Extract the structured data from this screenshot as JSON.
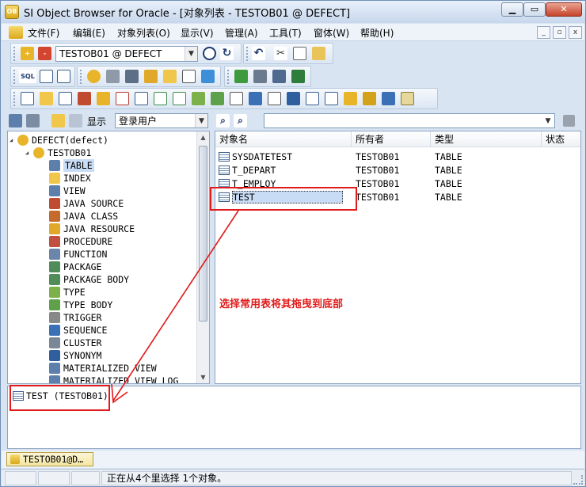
{
  "window": {
    "title": "SI Object Browser for Oracle - [对象列表 - TESTOB01 @ DEFECT]",
    "min_label": "▁",
    "max_label": "▭",
    "close_label": "✕"
  },
  "menu": {
    "items": [
      "文件(F)",
      "编辑(E)",
      "对象列表(O)",
      "显示(V)",
      "管理(A)",
      "工具(T)",
      "窗体(W)",
      "帮助(H)"
    ]
  },
  "toolbar1": {
    "connection": "TESTOB01 @ DEFECT"
  },
  "toolbar2": {
    "sql_label": "SQL"
  },
  "left": {
    "display_label": "显示",
    "display_value": "登录用户",
    "tree": [
      {
        "label": "DEFECT(defect)",
        "level": 0,
        "icon": "db-icon"
      },
      {
        "label": "TESTOB01",
        "level": 1,
        "icon": "user-icon"
      },
      {
        "label": "TABLE",
        "level": 2,
        "icon": "table-icon",
        "selected": true
      },
      {
        "label": "INDEX",
        "level": 2,
        "icon": "index-icon"
      },
      {
        "label": "VIEW",
        "level": 2,
        "icon": "view-icon"
      },
      {
        "label": "JAVA SOURCE",
        "level": 2,
        "icon": "java-source-icon"
      },
      {
        "label": "JAVA CLASS",
        "level": 2,
        "icon": "java-class-icon"
      },
      {
        "label": "JAVA RESOURCE",
        "level": 2,
        "icon": "java-resource-icon"
      },
      {
        "label": "PROCEDURE",
        "level": 2,
        "icon": "procedure-icon"
      },
      {
        "label": "FUNCTION",
        "level": 2,
        "icon": "function-icon"
      },
      {
        "label": "PACKAGE",
        "level": 2,
        "icon": "package-icon"
      },
      {
        "label": "PACKAGE BODY",
        "level": 2,
        "icon": "package-body-icon"
      },
      {
        "label": "TYPE",
        "level": 2,
        "icon": "type-icon"
      },
      {
        "label": "TYPE BODY",
        "level": 2,
        "icon": "type-body-icon"
      },
      {
        "label": "TRIGGER",
        "level": 2,
        "icon": "trigger-icon"
      },
      {
        "label": "SEQUENCE",
        "level": 2,
        "icon": "sequence-icon"
      },
      {
        "label": "CLUSTER",
        "level": 2,
        "icon": "cluster-icon"
      },
      {
        "label": "SYNONYM",
        "level": 2,
        "icon": "synonym-icon"
      },
      {
        "label": "MATERIALIZED VIEW",
        "level": 2,
        "icon": "mview-icon"
      },
      {
        "label": "MATERIALIZED VIEW LOG",
        "level": 2,
        "icon": "mview-log-icon"
      }
    ]
  },
  "right": {
    "columns": [
      "对象名",
      "所有者",
      "类型",
      "状态"
    ],
    "rows": [
      [
        "SYSDATETEST",
        "TESTOB01",
        "TABLE"
      ],
      [
        "T_DEPART",
        "TESTOB01",
        "TABLE"
      ],
      [
        "T_EMPLOY",
        "TESTOB01",
        "TABLE"
      ],
      [
        "TEST",
        "TESTOB01",
        "TABLE"
      ]
    ]
  },
  "favorites": {
    "item": "TEST (TESTOB01)"
  },
  "annotation": {
    "text": "选择常用表将其拖曳到底部"
  },
  "tab": {
    "label": "TESTOB01@D…"
  },
  "status": {
    "text": "正在从4个里选择 1个对象。"
  },
  "colors": {
    "accent": "#e11b1b",
    "selection": "#c9dcf5"
  }
}
